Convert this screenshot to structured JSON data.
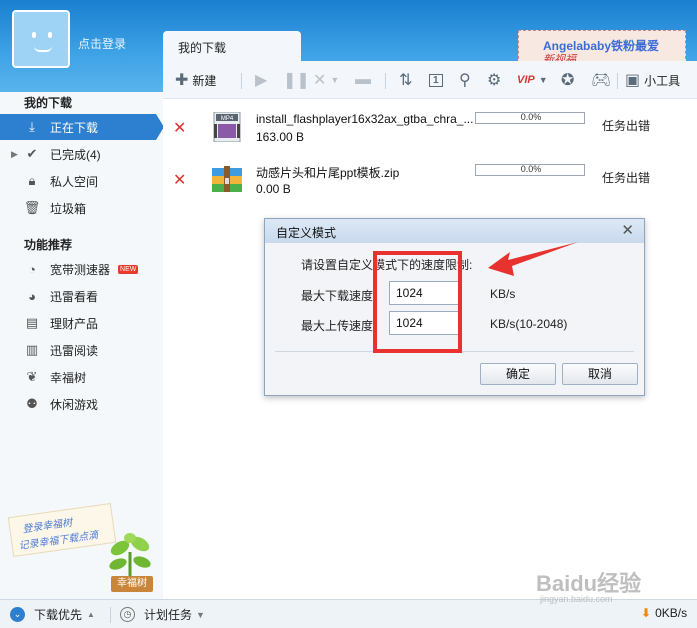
{
  "login_label": "点击登录",
  "tab_label": "我的下载",
  "banner": {
    "line1": "Angelababy铁粉最爱",
    "line2": "新视福"
  },
  "toolbar": {
    "new_label": "新建",
    "tools_label": "小工具"
  },
  "sidebar": {
    "section1": "我的下载",
    "items": [
      {
        "label": "正在下载",
        "icon": "download-icon"
      },
      {
        "label": "已完成(4)",
        "icon": "check-icon"
      },
      {
        "label": "私人空间",
        "icon": "lock-icon"
      },
      {
        "label": "垃圾箱",
        "icon": "trash-icon"
      }
    ],
    "section2": "功能推荐",
    "features": [
      {
        "label": "宽带测速器",
        "icon": "speedometer-icon",
        "badge": "NEW"
      },
      {
        "label": "迅雷看看",
        "icon": "video-icon"
      },
      {
        "label": "理财产品",
        "icon": "wallet-icon"
      },
      {
        "label": "迅雷阅读",
        "icon": "book-icon"
      },
      {
        "label": "幸福树",
        "icon": "leaf-icon"
      },
      {
        "label": "休闲游戏",
        "icon": "game-icon"
      }
    ],
    "promo": {
      "line1": "登录幸福树",
      "line2": "记录幸福下载点滴"
    },
    "plant_label": "幸福树"
  },
  "downloads": [
    {
      "name": "install_flashplayer16x32ax_gtba_chra_...",
      "size": "163.00 B",
      "progress": "0.0%",
      "status": "任务出错",
      "icon": "mp4-file-icon"
    },
    {
      "name": "动感片头和片尾ppt模板.zip",
      "size": "0.00 B",
      "progress": "0.0%",
      "status": "任务出错",
      "icon": "zip-file-icon"
    }
  ],
  "dialog": {
    "title": "自定义模式",
    "prompt": "请设置自定义模式下的速度限制:",
    "download_label": "最大下载速度",
    "download_value": "1024",
    "download_unit": "KB/s",
    "upload_label": "最大上传速度",
    "upload_value": "1024",
    "upload_unit": "KB/s(10-2048)",
    "ok": "确定",
    "cancel": "取消"
  },
  "statusbar": {
    "priority": "下载优先",
    "schedule": "计划任务",
    "speed": "0KB/s"
  },
  "watermark": {
    "main": "Baidu经验",
    "sub": "jingyan.baidu.com"
  },
  "colors": {
    "accent": "#2d7fd0",
    "error": "#d33333",
    "highlight": "#e8322f"
  }
}
